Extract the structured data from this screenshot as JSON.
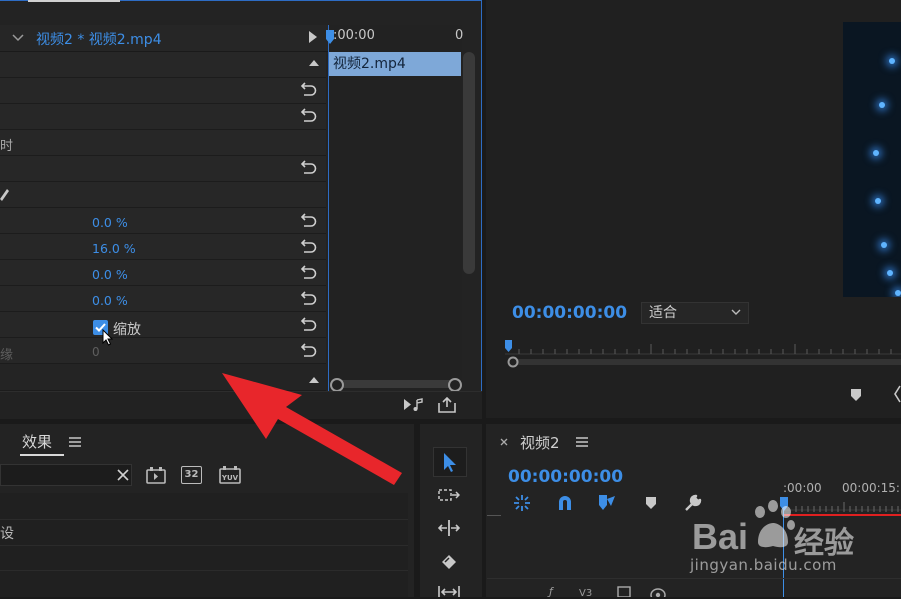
{
  "effect_controls": {
    "clip_label": "视频2 * 视频2.mp4",
    "timeline_start": ":00:00",
    "timeline_end": "0",
    "clip_name": "视频2.mp4",
    "row_label_partial": "时",
    "rows": [
      {
        "value": "0.0 %"
      },
      {
        "value": "16.0 %"
      },
      {
        "value": "0.0 %"
      },
      {
        "value": "0.0 %"
      }
    ],
    "uniform_scale_label": "缩放",
    "uniform_scale_checked": true,
    "edge_label_partial": "缘",
    "edge_value": "0"
  },
  "program_monitor": {
    "timecode": "00:00:00:00",
    "fit_option": "适合"
  },
  "effects_panel": {
    "tab_label": "效果",
    "row_label_partial": "设",
    "preset_badges": [
      "32"
    ]
  },
  "timeline": {
    "sequence_title": "视频2",
    "timecode": "00:00:00:00",
    "ruler_start": ":00:00",
    "ruler_mark": "00:00:15:"
  },
  "track_labels": [
    "V3"
  ],
  "watermark": {
    "brand": "Bai",
    "brand_cn": "经验",
    "url": "jingyan.baidu.com"
  },
  "colors": {
    "accent_blue": "#3d8ee6",
    "panel_bg": "#232323",
    "arrow_red": "#e8262b",
    "playhead_red": "#e02020"
  }
}
